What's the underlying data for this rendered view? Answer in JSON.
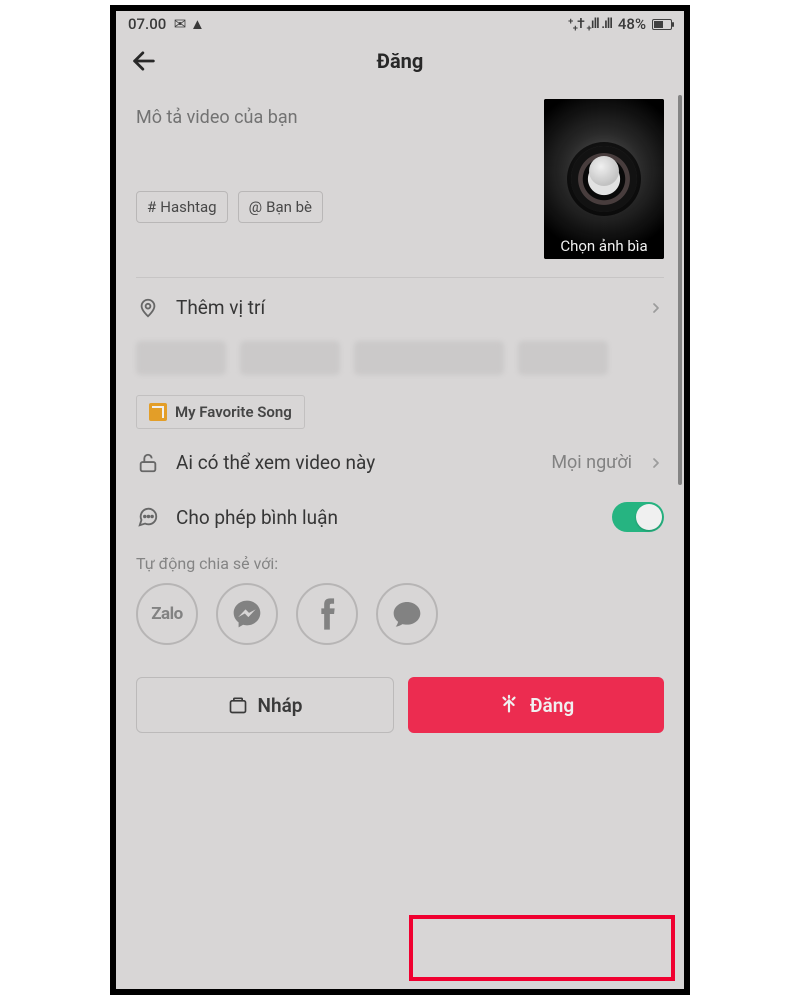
{
  "statusbar": {
    "time": "07.00",
    "battery_pct": "48%"
  },
  "header": {
    "title": "Đăng"
  },
  "description": {
    "placeholder": "Mô tả video của bạn",
    "hashtag_chip": "Hashtag",
    "friends_chip": "Bạn bè",
    "cover_label": "Chọn ảnh bìa"
  },
  "location": {
    "label": "Thêm vị trí"
  },
  "song": {
    "label": "My Favorite Song"
  },
  "privacy": {
    "label": "Ai có thể xem video này",
    "value": "Mọi người"
  },
  "comments": {
    "label": "Cho phép bình luận",
    "enabled": true
  },
  "share": {
    "label": "Tự động chia sẻ với:",
    "zalo": "Zalo"
  },
  "buttons": {
    "draft": "Nháp",
    "post": "Đăng"
  },
  "colors": {
    "accent": "#fb2f55",
    "toggle_on": "#29c08a",
    "highlight": "#ff0033"
  }
}
